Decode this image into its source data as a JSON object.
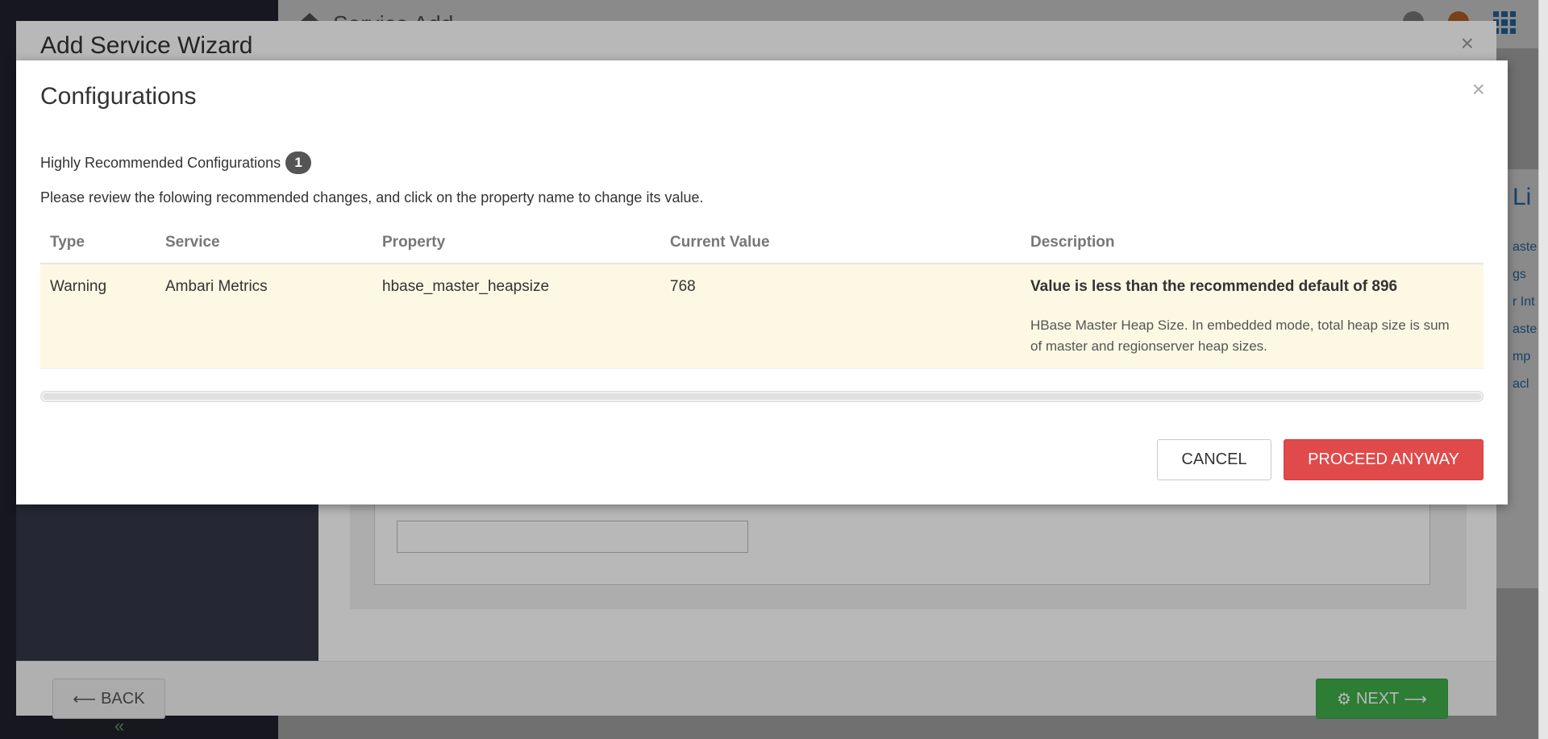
{
  "background_app": {
    "title": "Service Add",
    "right_panel_heading": "Li",
    "right_panel_links": [
      "aste",
      "gs",
      "r Int",
      "aste",
      "mp",
      "acl"
    ]
  },
  "wizard": {
    "title": "Add Service Wizard",
    "close_symbol": "×",
    "back_label": "BACK",
    "back_arrow": "⟵",
    "next_label": "NEXT",
    "next_arrow": "⟶",
    "next_spinner": "⚙"
  },
  "modal": {
    "title": "Configurations",
    "close_symbol": "×",
    "section_title": "Highly Recommended Configurations",
    "section_count": "1",
    "instruction": "Please review the folowing recommended changes, and click on the property name to change its value.",
    "table": {
      "headers": {
        "type": "Type",
        "service": "Service",
        "property": "Property",
        "current_value": "Current Value",
        "description": "Description"
      },
      "rows": [
        {
          "type": "Warning",
          "service": "Ambari Metrics",
          "property": "hbase_master_heapsize",
          "current_value": "768",
          "warning": "Value is less than the recommended default of 896",
          "description": "HBase Master Heap Size. In embedded mode, total heap size is sum of master and regionserver heap sizes."
        }
      ]
    },
    "cancel_label": "CANCEL",
    "proceed_label": "PROCEED ANYWAY"
  },
  "colors": {
    "proceed_button": "#e04a4a",
    "warning_row": "#fcf8e3",
    "next_button": "#3fae49",
    "badge": "#555555"
  }
}
